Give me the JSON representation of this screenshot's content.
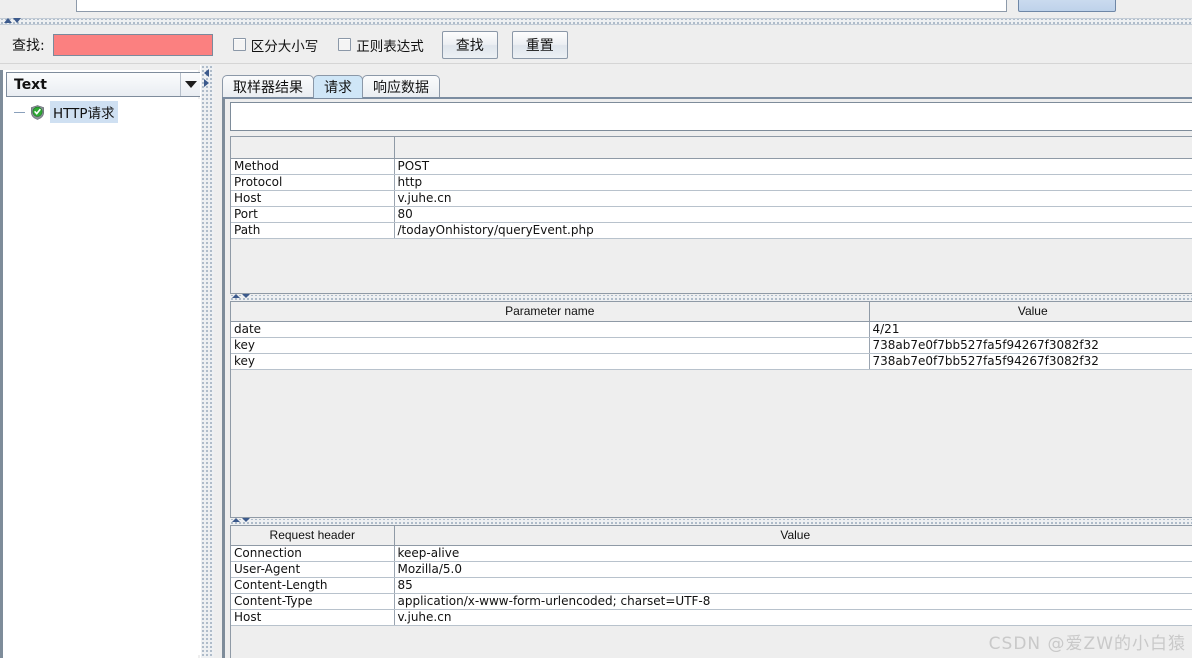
{
  "top_strip": {
    "cut_field_value": "",
    "cut_button_label": ""
  },
  "search_bar": {
    "label": "查找:",
    "input_value": "",
    "input_placeholder": "",
    "input_color": "#fb8080",
    "case_sensitive_label": "区分大小写",
    "regex_label": "正则表达式",
    "find_button": "查找",
    "reset_button": "重置"
  },
  "left_panel": {
    "combo_selected": "Text",
    "combo_icon": "chevron-down-icon",
    "tree": [
      {
        "label": "HTTP请求",
        "icon": "green-shield-icon",
        "selected": true
      }
    ]
  },
  "tabs": [
    {
      "label": "取样器结果",
      "active": false
    },
    {
      "label": "请求",
      "active": true
    },
    {
      "label": "响应数据",
      "active": false
    }
  ],
  "url_area": {
    "value": ""
  },
  "request_table": {
    "headers": [
      "",
      ""
    ],
    "rows": [
      {
        "name": "Method",
        "value": "POST"
      },
      {
        "name": "Protocol",
        "value": "http"
      },
      {
        "name": "Host",
        "value": "v.juhe.cn"
      },
      {
        "name": "Port",
        "value": "80"
      },
      {
        "name": "Path",
        "value": "/todayOnhistory/queryEvent.php"
      }
    ]
  },
  "parameter_table": {
    "headers": [
      "Parameter name",
      "Value"
    ],
    "rows": [
      {
        "name": "date",
        "value": "4/21"
      },
      {
        "name": "key",
        "value": "738ab7e0f7bb527fa5f94267f3082f32"
      },
      {
        "name": "key",
        "value": "738ab7e0f7bb527fa5f94267f3082f32"
      }
    ]
  },
  "header_table": {
    "headers": [
      "Request header",
      "Value"
    ],
    "rows": [
      {
        "name": "Connection",
        "value": "keep-alive"
      },
      {
        "name": "User-Agent",
        "value": "Mozilla/5.0"
      },
      {
        "name": "Content-Length",
        "value": "85"
      },
      {
        "name": "Content-Type",
        "value": "application/x-www-form-urlencoded; charset=UTF-8"
      },
      {
        "name": "Host",
        "value": "v.juhe.cn"
      }
    ]
  },
  "watermark": "CSDN @爱ZW的小白猿"
}
